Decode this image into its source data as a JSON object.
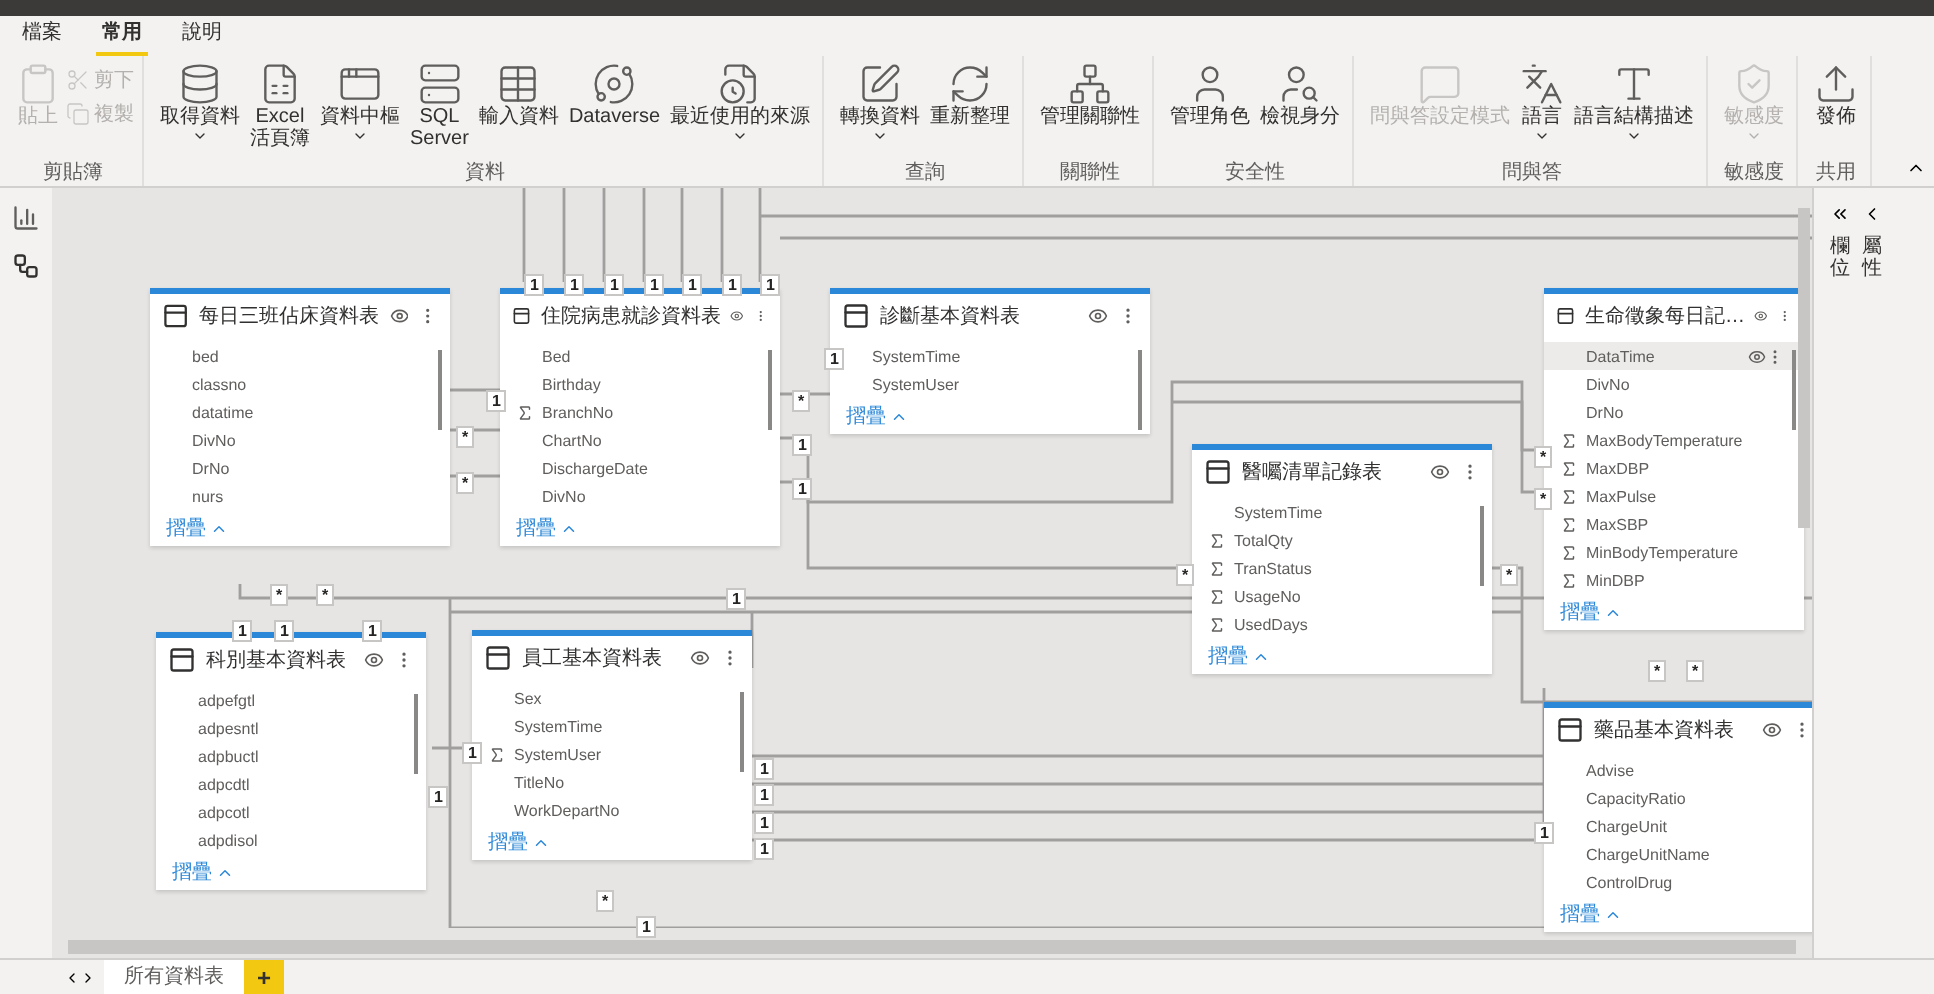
{
  "tabs": [
    {
      "label": "檔案",
      "selected": false
    },
    {
      "label": "常用",
      "selected": true
    },
    {
      "label": "說明",
      "selected": false
    }
  ],
  "ribbon_groups": [
    {
      "label": "剪貼簿",
      "buttons": [
        {
          "label": "貼上",
          "kind": "large",
          "disabled": true,
          "menu": false
        },
        {
          "label": "剪下",
          "kind": "small",
          "disabled": true,
          "menu": false
        },
        {
          "label": "複製",
          "kind": "small",
          "disabled": true,
          "menu": false
        }
      ]
    },
    {
      "label": "資料",
      "buttons": [
        {
          "label": "取得資料",
          "kind": "large",
          "disabled": false,
          "menu": true
        },
        {
          "label": "Excel\n活頁簿",
          "kind": "large",
          "disabled": false,
          "menu": false
        },
        {
          "label": "資料中樞",
          "kind": "large",
          "disabled": false,
          "menu": true
        },
        {
          "label": "SQL\nServer",
          "kind": "large",
          "disabled": false,
          "menu": false
        },
        {
          "label": "輸入資料",
          "kind": "large",
          "disabled": false,
          "menu": false
        },
        {
          "label": "Dataverse",
          "kind": "large",
          "disabled": false,
          "menu": false
        },
        {
          "label": "最近使用的來源",
          "kind": "large",
          "disabled": false,
          "menu": true
        }
      ]
    },
    {
      "label": "查詢",
      "buttons": [
        {
          "label": "轉換資料",
          "kind": "large",
          "disabled": false,
          "menu": true
        },
        {
          "label": "重新整理",
          "kind": "large",
          "disabled": false,
          "menu": false
        }
      ]
    },
    {
      "label": "關聯性",
      "buttons": [
        {
          "label": "管理關聯性",
          "kind": "large",
          "disabled": false,
          "menu": false
        }
      ]
    },
    {
      "label": "安全性",
      "buttons": [
        {
          "label": "管理角色",
          "kind": "large",
          "disabled": false,
          "menu": false
        },
        {
          "label": "檢視身分",
          "kind": "large",
          "disabled": false,
          "menu": false
        }
      ]
    },
    {
      "label": "問與答",
      "buttons": [
        {
          "label": "問與答設定模式",
          "kind": "large",
          "disabled": true,
          "menu": false
        },
        {
          "label": "語言",
          "kind": "large",
          "disabled": false,
          "menu": true
        },
        {
          "label": "語言結構描述",
          "kind": "large",
          "disabled": false,
          "menu": true
        }
      ]
    },
    {
      "label": "敏感度",
      "buttons": [
        {
          "label": "敏感度",
          "kind": "large",
          "disabled": true,
          "menu": true
        }
      ]
    },
    {
      "label": "共用",
      "buttons": [
        {
          "label": "發佈",
          "kind": "large",
          "disabled": false,
          "menu": false
        }
      ]
    }
  ],
  "tables": [
    {
      "title": "每日三班佔床資料表",
      "collapse": "摺疊",
      "fields": [
        {
          "name": "bed",
          "sum": false,
          "hovered": false
        },
        {
          "name": "classno",
          "sum": false,
          "hovered": false
        },
        {
          "name": "datatime",
          "sum": false,
          "hovered": false
        },
        {
          "name": "DivNo",
          "sum": false,
          "hovered": false
        },
        {
          "name": "DrNo",
          "sum": false,
          "hovered": false
        },
        {
          "name": "nurs",
          "sum": false,
          "hovered": false
        }
      ]
    },
    {
      "title": "住院病患就診資料表",
      "collapse": "摺疊",
      "fields": [
        {
          "name": "Bed",
          "sum": false,
          "hovered": false
        },
        {
          "name": "Birthday",
          "sum": false,
          "hovered": false
        },
        {
          "name": "BranchNo",
          "sum": true,
          "hovered": false
        },
        {
          "name": "ChartNo",
          "sum": false,
          "hovered": false
        },
        {
          "name": "DischargeDate",
          "sum": false,
          "hovered": false
        },
        {
          "name": "DivNo",
          "sum": false,
          "hovered": false
        }
      ]
    },
    {
      "title": "診斷基本資料表",
      "collapse": "摺疊",
      "fields": [
        {
          "name": "SystemTime",
          "sum": false,
          "hovered": false
        },
        {
          "name": "SystemUser",
          "sum": false,
          "hovered": false
        }
      ]
    },
    {
      "title": "醫囑清單記錄表",
      "collapse": "摺疊",
      "fields": [
        {
          "name": "SystemTime",
          "sum": false,
          "hovered": false
        },
        {
          "name": "TotalQty",
          "sum": true,
          "hovered": false
        },
        {
          "name": "TranStatus",
          "sum": true,
          "hovered": false
        },
        {
          "name": "UsageNo",
          "sum": true,
          "hovered": false
        },
        {
          "name": "UsedDays",
          "sum": true,
          "hovered": false
        }
      ]
    },
    {
      "title": "生命徵象每日記…",
      "collapse": "摺疊",
      "fields": [
        {
          "name": "DataTime",
          "sum": false,
          "hovered": true
        },
        {
          "name": "DivNo",
          "sum": false,
          "hovered": false
        },
        {
          "name": "DrNo",
          "sum": false,
          "hovered": false
        },
        {
          "name": "MaxBodyTemperature",
          "sum": true,
          "hovered": false
        },
        {
          "name": "MaxDBP",
          "sum": true,
          "hovered": false
        },
        {
          "name": "MaxPulse",
          "sum": true,
          "hovered": false
        },
        {
          "name": "MaxSBP",
          "sum": true,
          "hovered": false
        },
        {
          "name": "MinBodyTemperature",
          "sum": true,
          "hovered": false
        },
        {
          "name": "MinDBP",
          "sum": true,
          "hovered": false
        }
      ]
    },
    {
      "title": "科別基本資料表",
      "collapse": "摺疊",
      "fields": [
        {
          "name": "adpefgtl",
          "sum": false,
          "hovered": false
        },
        {
          "name": "adpesntl",
          "sum": false,
          "hovered": false
        },
        {
          "name": "adpbuctl",
          "sum": false,
          "hovered": false
        },
        {
          "name": "adpcdtl",
          "sum": false,
          "hovered": false
        },
        {
          "name": "adpcotl",
          "sum": false,
          "hovered": false
        },
        {
          "name": "adpdisol",
          "sum": false,
          "hovered": false
        }
      ]
    },
    {
      "title": "員工基本資料表",
      "collapse": "摺疊",
      "fields": [
        {
          "name": "Sex",
          "sum": false,
          "hovered": false
        },
        {
          "name": "SystemTime",
          "sum": false,
          "hovered": false
        },
        {
          "name": "SystemUser",
          "sum": true,
          "hovered": false
        },
        {
          "name": "TitleNo",
          "sum": false,
          "hovered": false
        },
        {
          "name": "WorkDepartNo",
          "sum": false,
          "hovered": false
        }
      ]
    },
    {
      "title": "藥品基本資料表",
      "collapse": "摺疊",
      "fields": [
        {
          "name": "Advise",
          "sum": false,
          "hovered": false
        },
        {
          "name": "CapacityRatio",
          "sum": false,
          "hovered": false
        },
        {
          "name": "ChargeUnit",
          "sum": false,
          "hovered": false
        },
        {
          "name": "ChargeUnitName",
          "sum": false,
          "hovered": false
        },
        {
          "name": "ControlDrug",
          "sum": false,
          "hovered": false
        }
      ]
    }
  ],
  "markers": [
    "1",
    "1",
    "1",
    "1",
    "1",
    "1",
    "1",
    "1",
    "*",
    "*",
    "*",
    "1",
    "1",
    "1",
    "*",
    "*",
    "*",
    "*",
    "*",
    "*",
    "*",
    "*",
    "1",
    "1",
    "1",
    "1",
    "1",
    "1",
    "1",
    "1",
    "1",
    "1",
    "*",
    "1",
    "1"
  ],
  "side_panes": [
    {
      "label": "欄位"
    },
    {
      "label": "屬性"
    }
  ],
  "page_tabs": [
    {
      "label": "所有資料表",
      "selected": true
    }
  ],
  "add_page": "+"
}
